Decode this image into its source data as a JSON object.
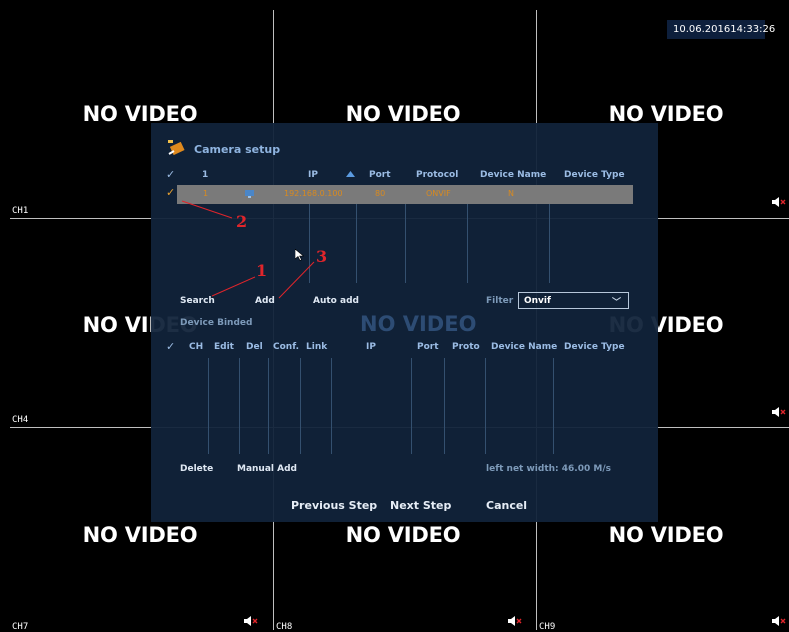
{
  "datetime": {
    "date": "10.06.2016",
    "time": "14:33:26"
  },
  "no_video_label": "NO VIDEO",
  "channels": {
    "ch1": "CH1",
    "ch4": "CH4",
    "ch7": "CH7",
    "ch8": "CH8",
    "ch9": "CH9"
  },
  "dialog": {
    "title": "Camera setup",
    "search_table": {
      "headers": {
        "index": "1",
        "ip": "IP",
        "port": "Port",
        "protocol": "Protocol",
        "device_name": "Device Name",
        "device_type": "Device Type"
      },
      "selected_row": {
        "index": "1",
        "ip": "192.168.0.100",
        "port": "80",
        "protocol": "ONVIF",
        "device_name": "N"
      }
    },
    "buttons": {
      "search": "Search",
      "add": "Add",
      "auto_add": "Auto add",
      "delete": "Delete",
      "manual_add": "Manual Add"
    },
    "filter": {
      "label": "Filter",
      "value": "Onvif"
    },
    "binded": {
      "title": "Device Binded",
      "headers": {
        "ch": "CH",
        "edit": "Edit",
        "del": "Del",
        "conf": "Conf.",
        "link": "Link",
        "ip": "IP",
        "port": "Port",
        "proto": "Proto",
        "device_name": "Device Name",
        "device_type": "Device Type"
      }
    },
    "net_width": "left net width:  46.00 M/s",
    "footer": {
      "previous": "Previous Step",
      "next": "Next Step",
      "cancel": "Cancel"
    }
  },
  "annotations": {
    "a1": "1",
    "a2": "2",
    "a3": "3"
  },
  "colors": {
    "accent": "#d88a20",
    "annotation": "#e0252b",
    "panel": "#11233a"
  }
}
